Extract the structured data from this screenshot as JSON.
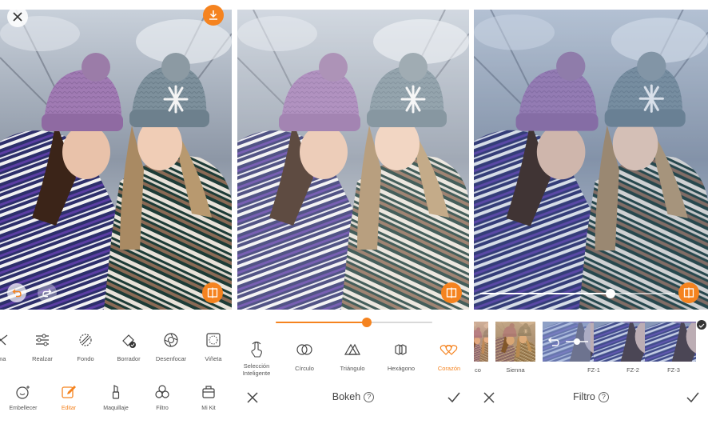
{
  "accent_color": "#f5831f",
  "panel1": {
    "tools": [
      {
        "label": "rma",
        "icon": "slice-icon"
      },
      {
        "label": "Realzar",
        "icon": "sliders-icon"
      },
      {
        "label": "Fondo",
        "icon": "background-icon"
      },
      {
        "label": "Borrador",
        "icon": "eraser-icon"
      },
      {
        "label": "Desenfocar",
        "icon": "aperture-icon"
      },
      {
        "label": "Viñeta",
        "icon": "vignette-icon"
      }
    ],
    "tabs": [
      {
        "label": "Embellecer",
        "icon": "face-sparkle-icon"
      },
      {
        "label": "Editar",
        "icon": "edit-icon"
      },
      {
        "label": "Maquillaje",
        "icon": "lipstick-icon"
      },
      {
        "label": "Filtro",
        "icon": "filter-circles-icon"
      },
      {
        "label": "Mi Kit",
        "icon": "kit-icon"
      }
    ],
    "active_tab": "Editar"
  },
  "panel2": {
    "slider_value": 0.58,
    "shapes": [
      {
        "label": "Selección\nInteligente",
        "icon": "hand-touch-icon"
      },
      {
        "label": "Círculo",
        "icon": "circles-icon"
      },
      {
        "label": "Triángulo",
        "icon": "triangles-icon"
      },
      {
        "label": "Hexágono",
        "icon": "hexagons-icon"
      },
      {
        "label": "Corazón",
        "icon": "hearts-icon"
      }
    ],
    "active_shape": "Corazón",
    "title": "Bokeh",
    "help": "?"
  },
  "panel3": {
    "slider_value": 0.67,
    "filters": [
      {
        "label": "co"
      },
      {
        "label": "Sienna"
      },
      {
        "label": "FZ-1"
      },
      {
        "label": "FZ-2"
      },
      {
        "label": "FZ-3"
      }
    ],
    "title": "Filtro",
    "help": "?"
  }
}
